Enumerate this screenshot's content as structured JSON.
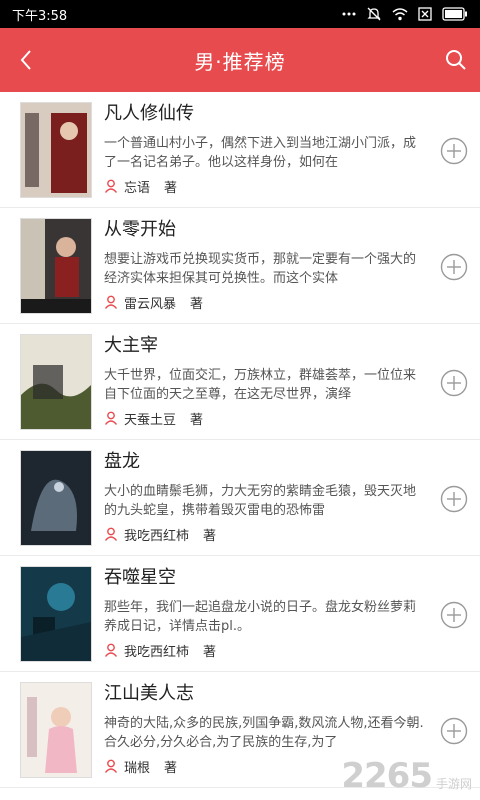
{
  "status_bar": {
    "time": "下午3:58"
  },
  "header": {
    "title": "男·推荐榜"
  },
  "books": [
    {
      "title": "凡人修仙传",
      "description": "一个普通山村小子，偶然下进入到当地江湖小门派，成了一名记名弟子。他以这样身份，如何在",
      "author": "忘语",
      "role": "著"
    },
    {
      "title": "从零开始",
      "description": "想要让游戏币兑换现实货币，那就一定要有一个强大的经济实体来担保其可兑换性。而这个实体",
      "author": "雷云风暴",
      "role": "著"
    },
    {
      "title": "大主宰",
      "description": "大千世界，位面交汇，万族林立，群雄荟萃，一位位来自下位面的天之至尊，在这无尽世界，演绎",
      "author": "天蚕土豆",
      "role": "著"
    },
    {
      "title": "盘龙",
      "description": "大小的血睛鬃毛狮，力大无穷的紫睛金毛猿，毁天灭地的九头蛇皇，携带着毁灭雷电的恐怖雷",
      "author": "我吃西红柿",
      "role": "著"
    },
    {
      "title": "吞噬星空",
      "description": "那些年，我们一起追盘龙小说的日子。盘龙女粉丝萝莉养成日记，详情点击pl.。",
      "author": "我吃西红柿",
      "role": "著"
    },
    {
      "title": "江山美人志",
      "description": "神奇的大陆,众多的民族,列国争霸,数风流人物,还看今朝.合久必分,分久必合,为了民族的生存,为了",
      "author": "瑞根",
      "role": "著"
    }
  ],
  "watermark": {
    "number": "2265",
    "suffix": "手游网"
  },
  "colors": {
    "accent": "#e84b4e",
    "status_bar": "#000000"
  }
}
